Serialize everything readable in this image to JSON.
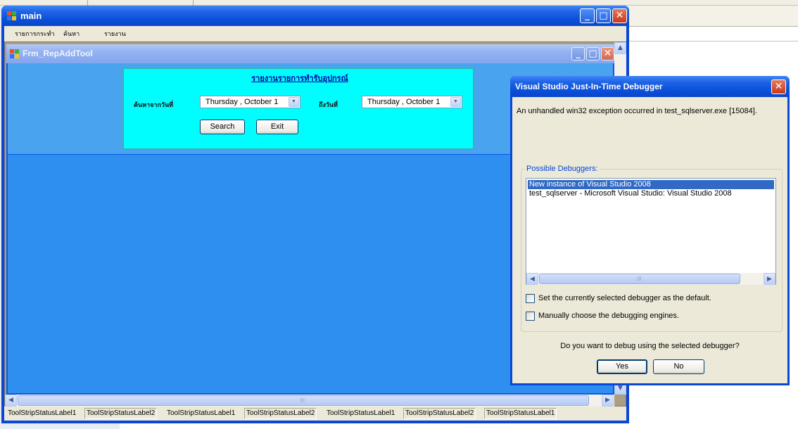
{
  "main_window": {
    "title": "main",
    "menu": [
      "รายการกระทำ",
      "ค้นหา",
      "รายงาน"
    ]
  },
  "child_window": {
    "title": "Frm_RepAddTool",
    "panel": {
      "title": "รายงานรายการทำรับอุปกรณ์",
      "from_label": "ค้นหาจากวันที่",
      "to_label": "ถึงวันที่",
      "from_date": "Thursday  ,  October  1",
      "to_date": "Thursday  ,  October  1",
      "search_label": "Search",
      "exit_label": "Exit",
      "accent": "#00fefe"
    }
  },
  "status_strip": {
    "labels": [
      "ToolStripStatusLabel1",
      "ToolStripStatusLabel2",
      "ToolStripStatusLabel1",
      "ToolStripStatusLabel2",
      "ToolStripStatusLabel1",
      "ToolStripStatusLabel2",
      "ToolStripStatusLabel1"
    ]
  },
  "scrollbar_grip": "III",
  "dialog": {
    "title": "Visual Studio Just-In-Time Debugger",
    "message": "An unhandled win32 exception occurred in test_sqlserver.exe [15084].",
    "group_title": "Possible Debuggers:",
    "debuggers": [
      "New instance of Visual Studio 2008",
      "test_sqlserver - Microsoft Visual Studio: Visual Studio 2008"
    ],
    "selected_index": 0,
    "set_default_label": "Set the currently selected debugger as the default.",
    "manual_label": "Manually choose the debugging engines.",
    "question": "Do you want to debug using the selected debugger?",
    "yes_label": "Yes",
    "no_label": "No"
  },
  "colors": {
    "titlebar_blue": "#0a4fd8",
    "mdi_child_blue": "#2f8ff0",
    "selection_blue": "#316ac5",
    "close_red": "#c6391a"
  },
  "icons": {
    "minimize": "minimize-icon",
    "maximize": "maximize-icon",
    "close": "close-icon",
    "app": "windows-form-icon"
  }
}
